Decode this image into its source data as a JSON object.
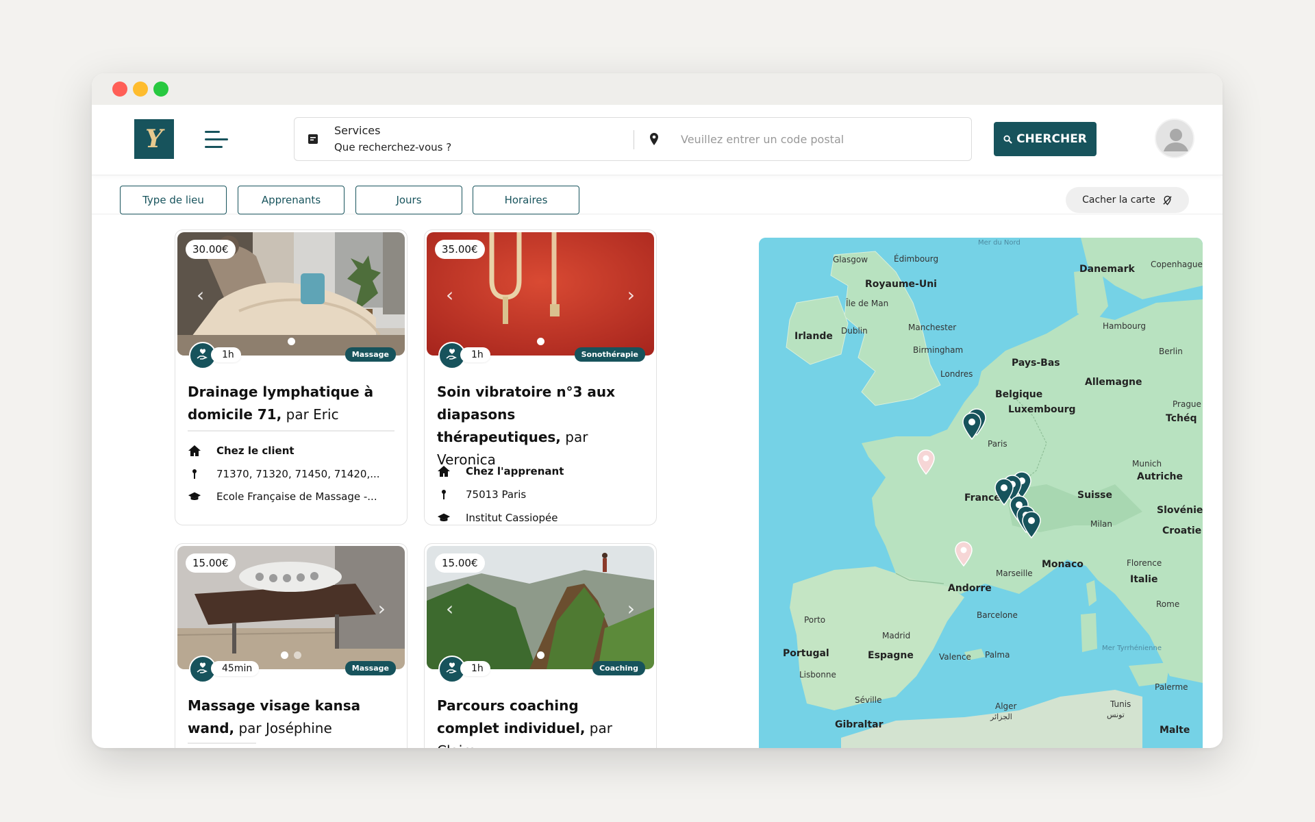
{
  "header": {
    "logo_text": "Y",
    "search": {
      "title": "Services",
      "subtitle": "Que recherchez-vous ?",
      "postal_placeholder": "Veuillez entrer un code postal"
    },
    "search_button": "CHERCHER"
  },
  "filters": [
    "Type de lieu",
    "Apprenants",
    "Jours",
    "Horaires"
  ],
  "hide_map_label": "Cacher la carte",
  "cards": [
    {
      "price": "30.00€",
      "duration": "1h",
      "tag": "Massage",
      "title_bold": "Drainage lymphatique à domicile 71,",
      "title_author": "par Eric",
      "location_type": "Chez le client",
      "postal": "71370, 71320, 71450, 71420,...",
      "school": "Ecole Française de Massage -..."
    },
    {
      "price": "35.00€",
      "duration": "1h",
      "tag": "Sonothérapie",
      "title_bold": "Soin vibratoire n°3 aux diapasons thérapeutiques,",
      "title_author": "par Veronica",
      "location_type": "Chez l'apprenant",
      "postal": "75013 Paris",
      "school": "Institut Cassiopée"
    },
    {
      "price": "15.00€",
      "duration": "45min",
      "tag": "Massage",
      "title_bold": "Massage visage kansa wand,",
      "title_author": "par Joséphine"
    },
    {
      "price": "15.00€",
      "duration": "1h",
      "tag": "Coaching",
      "title_bold": "Parcours coaching complet individuel,",
      "title_author": "par Claire"
    }
  ],
  "map": {
    "labels": {
      "mer_du_nord": "Mer du Nord",
      "glasgow": "Glasgow",
      "edimbourg": "Édimbourg",
      "royaume_uni": "Royaume-Uni",
      "ile_de_man": "Île de Man",
      "irlande": "Irlande",
      "dublin": "Dublin",
      "manchester": "Manchester",
      "birmingham": "Birmingham",
      "londres": "Londres",
      "danemark": "Danemark",
      "copenhague": "Copenhague",
      "hambourg": "Hambourg",
      "berlin": "Berlin",
      "pays_bas": "Pays-Bas",
      "allemagne": "Allemagne",
      "belgique": "Belgique",
      "luxembourg": "Luxembourg",
      "prague": "Prague",
      "tcheq": "Tchéq",
      "paris": "Paris",
      "munich": "Munich",
      "autriche": "Autriche",
      "france": "France",
      "suisse": "Suisse",
      "slovenie": "Slovénie",
      "milan": "Milan",
      "croatie": "Croatie",
      "florence": "Florence",
      "monaco": "Monaco",
      "italie": "Italie",
      "marseille": "Marseille",
      "andorre": "Andorre",
      "rome": "Rome",
      "porto": "Porto",
      "barcelone": "Barcelone",
      "madrid": "Madrid",
      "portugal": "Portugal",
      "espagne": "Espagne",
      "valence": "Valence",
      "palma": "Palma",
      "mer_tyrrhenienne": "Mer Tyrrhénienne",
      "lisbonne": "Lisbonne",
      "seville": "Séville",
      "palerme": "Palerme",
      "alger": "Alger",
      "alger_ar": "الجزائر",
      "tunis": "Tunis",
      "tunis_ar": "تونس",
      "gibraltar": "Gibraltar",
      "malte": "Malte"
    }
  },
  "colors": {
    "brand": "#17535c",
    "logo_gold": "#e7c98e",
    "sea": "#75d2e6",
    "land": "#b8e2c0"
  }
}
